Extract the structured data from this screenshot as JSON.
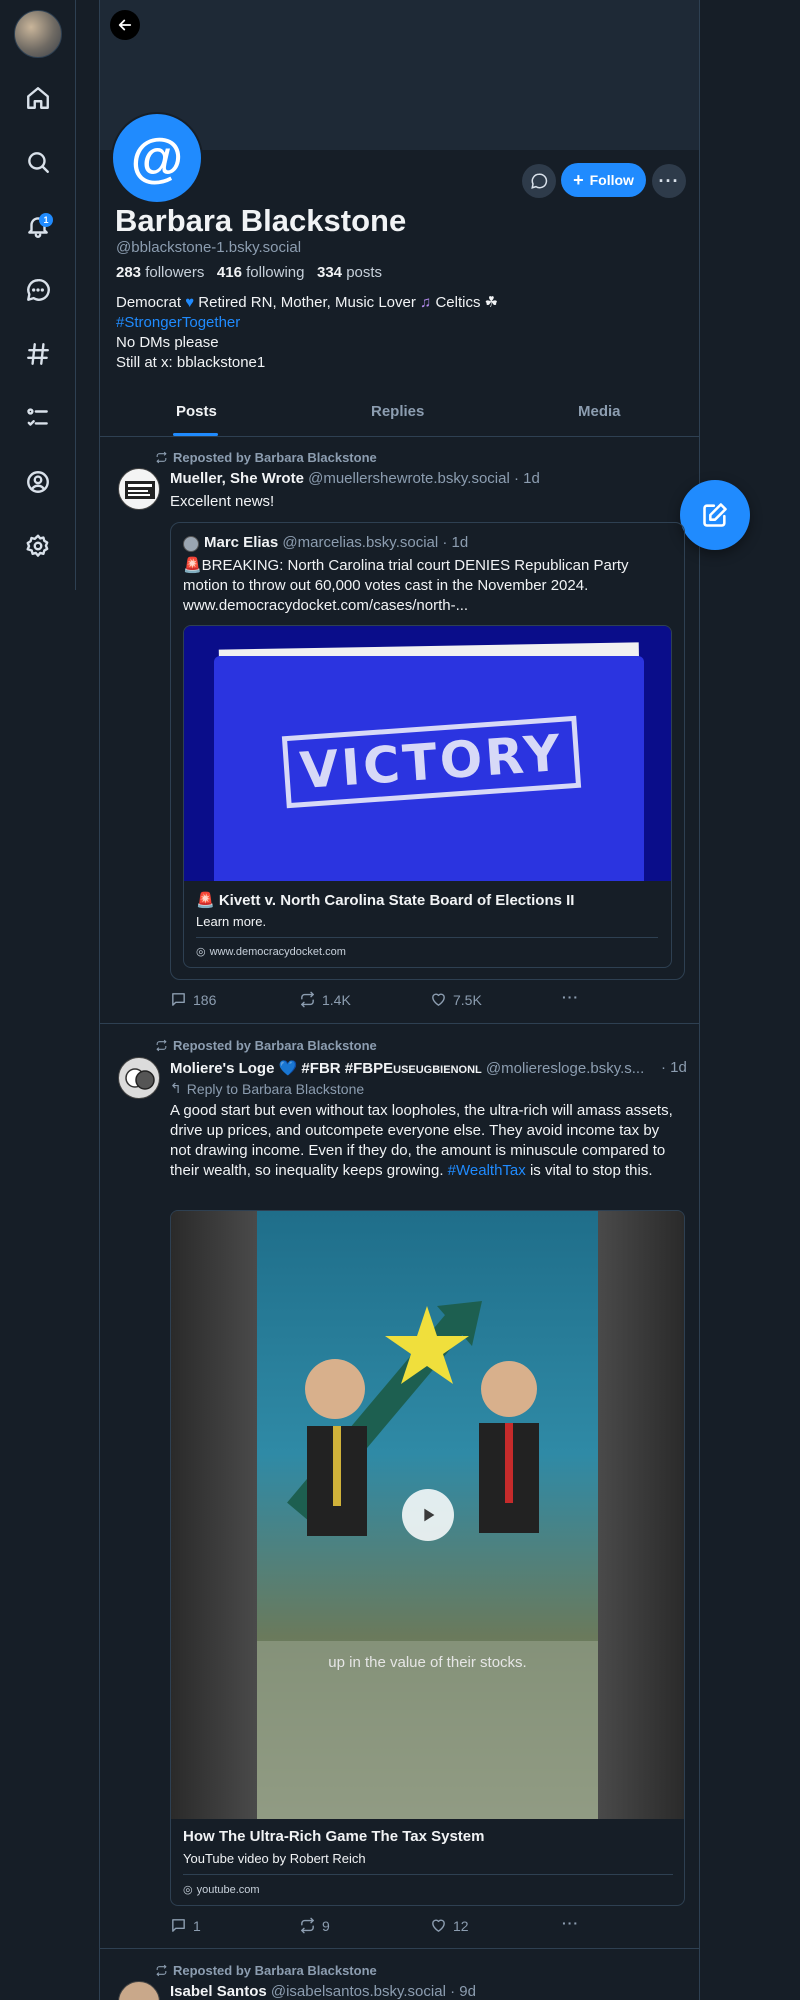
{
  "nav": {
    "notifications_badge": "1",
    "items": [
      "home-icon",
      "search-icon",
      "bell-icon",
      "chat-icon",
      "hash-icon",
      "list-icon",
      "profile-icon",
      "gear-icon"
    ]
  },
  "profile": {
    "avatar_glyph": "@",
    "display_name": "Barbara Blackstone",
    "handle": "@bblackstone-1.bsky.social",
    "followers_count": "283",
    "followers_label": "followers",
    "following_count": "416",
    "following_label": "following",
    "posts_count": "334",
    "posts_label": "posts",
    "follow_label": "Follow",
    "bio": {
      "line1_a": "Democrat",
      "line1_b": " Retired RN, Mother, Music Lover",
      "line1_c": " Celtics ☘",
      "hashtag": "#StrongerTogether",
      "line3": "No DMs please",
      "line4": "Still at x: bblackstone1"
    }
  },
  "tabs": {
    "posts": "Posts",
    "replies": "Replies",
    "media": "Media"
  },
  "posts": [
    {
      "repost_label": "Reposted by Barbara Blackstone",
      "author_name": "Mueller, She Wrote",
      "author_handle": "@muellershewrote.bsky.social · 1d",
      "text": "Excellent news!",
      "quote": {
        "author_name": "Marc Elias",
        "author_handle": "@marcelias.bsky.social · 1d",
        "text": "🚨BREAKING: North Carolina trial court DENIES Republican Party motion to throw out 60,000 votes cast in the November 2024. www.democracydocket.com/cases/north-...",
        "image_text": "VICTORY",
        "card_title": "🚨 Kivett v. North Carolina State Board of Elections II",
        "card_desc": "Learn more.",
        "card_domain": "www.democracydocket.com"
      },
      "replies": "186",
      "reposts": "1.4K",
      "likes": "7.5K"
    },
    {
      "repost_label": "Reposted by Barbara Blackstone",
      "author_name": "Moliere's Loge 💙 #FBR #FBPE",
      "author_suffix": "USEUGBIENONL",
      "author_handle": "@molieresloge.bsky.s...",
      "time": "· 1d",
      "reply_to": "Reply to Barbara Blackstone",
      "text": "A good start but even without tax loopholes, the ultra-rich will amass assets, drive up prices, and outcompete everyone else. They avoid income tax by not drawing income. Even if they do, the amount is minuscule compared to their wealth, so inequality keeps growing.",
      "hashtag": "#WealthTax",
      "text_tail": " is vital to stop this.",
      "video_caption": "up in the value of their stocks.",
      "card_title": "How The Ultra-Rich Game The Tax System",
      "card_desc": "YouTube video by Robert Reich",
      "card_domain": "youtube.com",
      "replies": "1",
      "reposts": "9",
      "likes": "12"
    },
    {
      "repost_label": "Reposted by Barbara Blackstone",
      "author_name": "Isabel Santos",
      "author_handle": "@isabelsantos.bsky.social · 9d"
    }
  ],
  "colors": {
    "background": "#161e27",
    "accent": "#208bfe",
    "border": "#2e4052",
    "muted_text": "#8c9db0"
  }
}
